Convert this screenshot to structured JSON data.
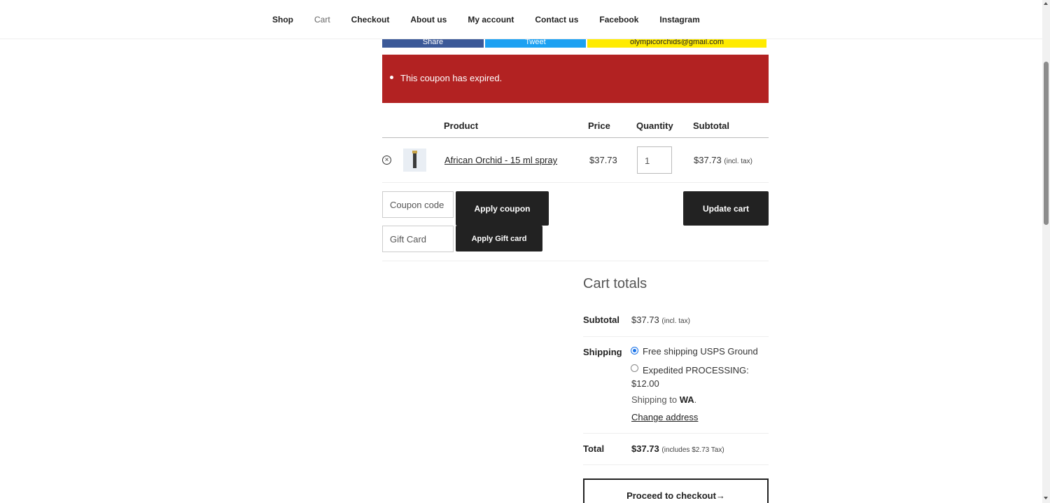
{
  "nav": {
    "items": [
      "Shop",
      "Cart",
      "Checkout",
      "About us",
      "My account",
      "Contact us",
      "Facebook",
      "Instagram"
    ],
    "current": "Cart"
  },
  "share": {
    "facebook": "Share",
    "twitter": "Tweet",
    "email": "olympicorchids@gmail.com"
  },
  "notice": {
    "message": "This coupon has expired."
  },
  "cart": {
    "headers": {
      "product": "Product",
      "price": "Price",
      "quantity": "Quantity",
      "subtotal": "Subtotal"
    },
    "item": {
      "name": "African Orchid - 15 ml spray",
      "price": "$37.73",
      "quantity": "1",
      "subtotal": "$37.73",
      "tax_note": "(incl. tax)"
    },
    "coupon_placeholder": "Coupon code",
    "apply_coupon": "Apply coupon",
    "gift_placeholder": "Gift Card",
    "apply_gift": "Apply Gift card",
    "update_cart": "Update cart"
  },
  "totals": {
    "title": "Cart totals",
    "subtotal_label": "Subtotal",
    "subtotal_value": "$37.73",
    "subtotal_note": "(incl. tax)",
    "shipping_label": "Shipping",
    "shipping_options": [
      "Free shipping USPS Ground",
      "Expedited PROCESSING: $12.00"
    ],
    "shipping_to_prefix": "Shipping to",
    "shipping_to_state": "WA",
    "change_address": "Change address",
    "total_label": "Total",
    "total_value": "$37.73",
    "total_note": "(includes $2.73 Tax)",
    "checkout": "Proceed to checkout→"
  },
  "colors": {
    "notice_bg": "#b22222",
    "button_dark": "#222222",
    "facebook": "#3b5998",
    "twitter": "#1da1f2",
    "email": "#ffeb00"
  }
}
